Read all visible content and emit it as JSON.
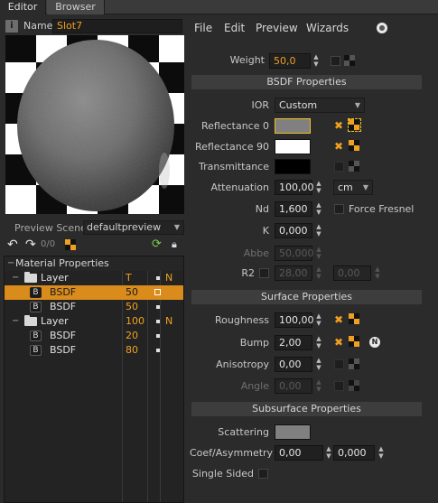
{
  "tabs": [
    {
      "label": "Editor"
    },
    {
      "label": "Browser"
    }
  ],
  "name": {
    "label": "Name",
    "value": "Slot7",
    "icon": "info-icon"
  },
  "preview": {
    "scene_label": "Preview Scene",
    "scene_value": "defaultpreview"
  },
  "toolbar": {
    "counter": "0/0"
  },
  "tree": {
    "header": {
      "title": "Material Properties",
      "col_t": "T",
      "col_n": "N"
    },
    "rows": [
      {
        "type": "Layer",
        "label": "Layer",
        "t": "",
        "depth": 0
      },
      {
        "type": "BSDF",
        "label": "BSDF",
        "t": "50",
        "depth": 1,
        "selected": true
      },
      {
        "type": "BSDF",
        "label": "BSDF",
        "t": "50",
        "depth": 1
      },
      {
        "type": "Layer",
        "label": "Layer",
        "t": "100",
        "depth": 0,
        "n": "N"
      },
      {
        "type": "BSDF",
        "label": "BSDF",
        "t": "20",
        "depth": 1
      },
      {
        "type": "BSDF",
        "label": "BSDF",
        "t": "80",
        "depth": 1
      }
    ]
  },
  "menu": {
    "file": "File",
    "edit": "Edit",
    "preview": "Preview",
    "wizards": "Wizards"
  },
  "weight": {
    "label": "Weight",
    "value": "50,0"
  },
  "bsdf": {
    "header": "BSDF Properties",
    "ior_label": "IOR",
    "ior_value": "Custom",
    "reflectance0_label": "Reflectance 0",
    "reflectance90_label": "Reflectance 90",
    "transmittance_label": "Transmittance",
    "attenuation_label": "Attenuation",
    "attenuation_value": "100,00",
    "attenuation_unit": "cm",
    "nd_label": "Nd",
    "nd_value": "1,600",
    "force_fresnel_label": "Force Fresnel",
    "k_label": "K",
    "k_value": "0,000",
    "abbe_label": "Abbe",
    "abbe_value": "50,000",
    "r2_label": "R2",
    "r2_value1": "28,00",
    "r2_value2": "0,00"
  },
  "surface": {
    "header": "Surface Properties",
    "roughness_label": "Roughness",
    "roughness_value": "100,00",
    "bump_label": "Bump",
    "bump_value": "2,00",
    "anisotropy_label": "Anisotropy",
    "anisotropy_value": "0,00",
    "angle_label": "Angle",
    "angle_value": "0,00"
  },
  "subsurface": {
    "header": "Subsurface Properties",
    "scattering_label": "Scattering",
    "coef_label": "Coef/Asymmetry",
    "coef_value1": "0,00",
    "coef_value2": "0,000",
    "single_sided_label": "Single Sided"
  },
  "colors": {
    "accent": "#f0a020",
    "reflectance0": "#808080",
    "reflectance90": "#ffffff",
    "transmittance": "#000000",
    "scattering": "#808080"
  }
}
